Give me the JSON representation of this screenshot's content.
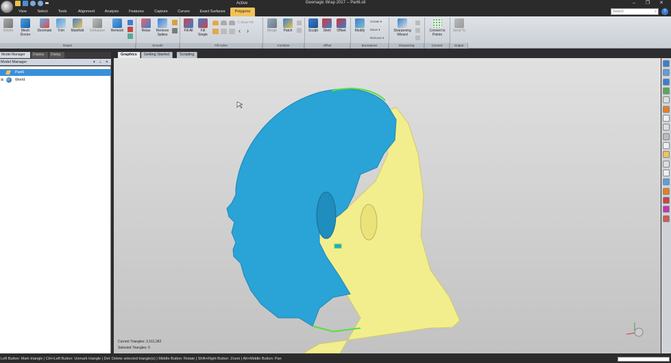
{
  "window": {
    "title": "Geomagic Wrap 2017 -- Part6.stl",
    "context_label": "Active"
  },
  "menu": {
    "tabs": [
      "View",
      "Select",
      "Tools",
      "Alignment",
      "Analysis",
      "Features",
      "Capture",
      "Curves",
      "Exact Surfaces",
      "Polygons"
    ],
    "active_tab": "Polygons",
    "search_placeholder": "Search"
  },
  "ribbon": {
    "buttons": [
      {
        "label": "Delete",
        "icon": "x-delete-icon"
      },
      {
        "label": "Mesh Doctor",
        "icon": "mesh-doctor-icon"
      },
      {
        "label": "Decimate",
        "icon": "decimate-icon"
      },
      {
        "label": "Trim",
        "icon": "trim-icon"
      },
      {
        "label": "Manifold",
        "icon": "manifold-icon"
      },
      {
        "label": "Defeature",
        "icon": "defeature-icon"
      },
      {
        "label": "Remesh",
        "icon": "remesh-icon"
      },
      {
        "label": "Relax",
        "icon": "relax-icon"
      },
      {
        "label": "Remove Spikes",
        "icon": "remove-spikes-icon"
      },
      {
        "label": "Fill All",
        "icon": "fill-all-icon"
      },
      {
        "label": "Fill Single",
        "icon": "fill-single-icon"
      },
      {
        "label": "Merge",
        "icon": "merge-icon"
      },
      {
        "label": "Patch",
        "icon": "patch-icon"
      },
      {
        "label": "Sculpt",
        "icon": "sculpt-icon"
      },
      {
        "label": "Shell",
        "icon": "shell-icon"
      },
      {
        "label": "Offset",
        "icon": "offset-icon"
      },
      {
        "label": "Modify",
        "icon": "modify-icon"
      },
      {
        "label": "Sharpening Wizard",
        "icon": "sharpening-wizard-icon"
      },
      {
        "label": "Convert to Points",
        "icon": "convert-to-points-icon"
      },
      {
        "label": "Send To",
        "icon": "send-to-icon"
      }
    ],
    "small_buttons": {
      "show_fill": "Show Fill",
      "create": "Create",
      "move": "Move",
      "remove": "Remove"
    },
    "groups": [
      "Repair",
      "Smooth",
      "Fill Holes",
      "Combine",
      "Offset",
      "Boundaries",
      "Sharpening",
      "Convert",
      "Output"
    ]
  },
  "left_panel": {
    "tabs": [
      "Model Manager",
      "Display",
      "Dialog"
    ],
    "active_tab": "Model Manager",
    "header": "Model Manager",
    "tree": [
      {
        "label": "Part6",
        "selected": true
      },
      {
        "label": "World",
        "selected": false
      }
    ]
  },
  "viewport": {
    "tabs": [
      "Graphics",
      "Getting Started",
      "Scripting"
    ],
    "active_tab": "Graphics",
    "current_triangles": "Current Triangles: 3,161,282",
    "selected_triangles": "Selected Triangles: 0",
    "colors": {
      "mesh_blue": "#2aa3d6",
      "mesh_yellow": "#f2ee8e",
      "boundary_green": "#55e03a",
      "background_top": "#e0e0e0",
      "background_bottom": "#c2c2c2"
    }
  },
  "status": {
    "text": "Left Button: Mark triangle | Ctrl+Left Button: Unmark triangle | Del: Delete selected triangle(s) | Middle Button: Rotate | Shift+Right Button: Zoom | Alt+Middle Button: Pan"
  }
}
